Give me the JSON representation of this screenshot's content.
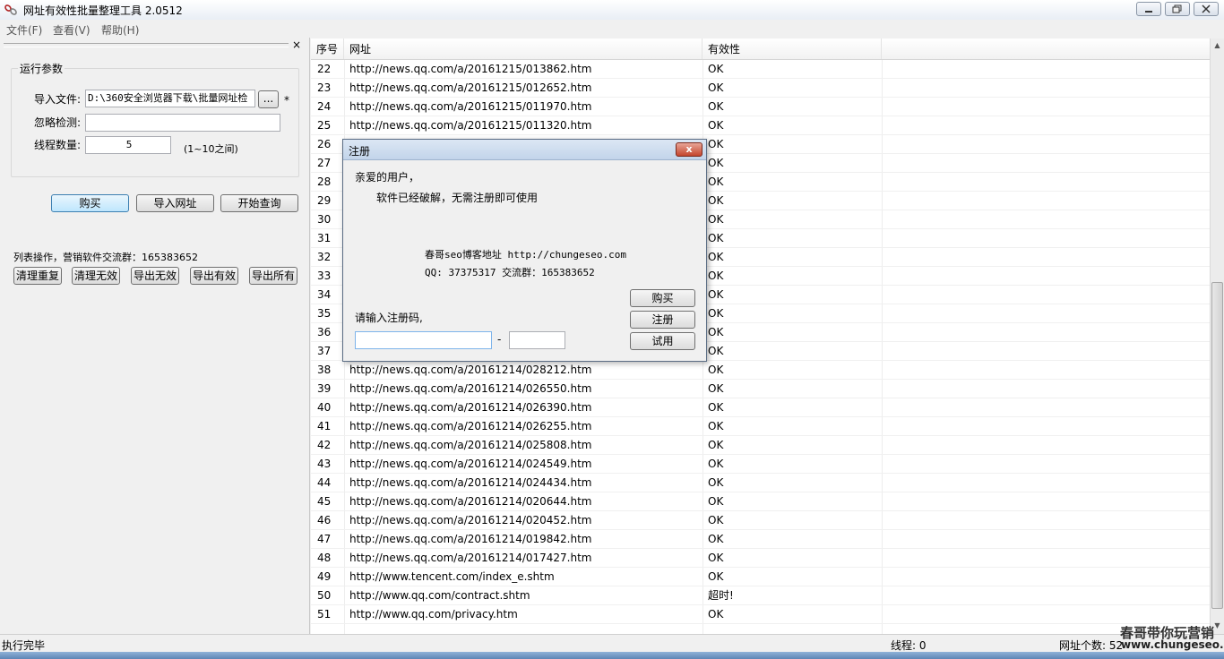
{
  "window": {
    "title": "网址有效性批量整理工具 2.0512",
    "min_icon": "minimize-icon",
    "max_icon": "maximize-icon",
    "close_icon": "close-icon"
  },
  "menu": [
    "文件(F)",
    "查看(V)",
    "帮助(H)"
  ],
  "panel": {
    "group_title": "运行参数",
    "import_label": "导入文件:",
    "import_value": "D:\\360安全浏览器下载\\批量网址检",
    "browse_label": "...",
    "asterisk": "*",
    "ignore_label": "忽略检测:",
    "ignore_value": "",
    "threads_label": "线程数量:",
    "threads_value": "5",
    "threads_hint": "(1~10之间)",
    "buttons": {
      "buy": "购买",
      "import": "导入网址",
      "start": "开始查询"
    },
    "list_ops": "列表操作，营销软件交流群：165383652",
    "list_buttons": [
      "清理重复",
      "清理无效",
      "导出无效",
      "导出有效",
      "导出所有"
    ],
    "close_glyph": "×"
  },
  "table": {
    "columns": [
      "序号",
      "网址",
      "有效性"
    ],
    "rows": [
      {
        "n": "22",
        "url": "http://news.qq.com/a/20161215/013862.htm",
        "status": "OK"
      },
      {
        "n": "23",
        "url": "http://news.qq.com/a/20161215/012652.htm",
        "status": "OK"
      },
      {
        "n": "24",
        "url": "http://news.qq.com/a/20161215/011970.htm",
        "status": "OK"
      },
      {
        "n": "25",
        "url": "http://news.qq.com/a/20161215/011320.htm",
        "status": "OK"
      },
      {
        "n": "26",
        "url": "",
        "status": "OK"
      },
      {
        "n": "27",
        "url": "",
        "status": "OK"
      },
      {
        "n": "28",
        "url": "",
        "status": "OK"
      },
      {
        "n": "29",
        "url": "",
        "status": "OK"
      },
      {
        "n": "30",
        "url": "",
        "status": "OK"
      },
      {
        "n": "31",
        "url": "",
        "status": "OK"
      },
      {
        "n": "32",
        "url": "",
        "status": "OK"
      },
      {
        "n": "33",
        "url": "",
        "status": "OK"
      },
      {
        "n": "34",
        "url": "",
        "status": "OK"
      },
      {
        "n": "35",
        "url": "",
        "status": "OK"
      },
      {
        "n": "36",
        "url": "",
        "status": "OK"
      },
      {
        "n": "37",
        "url": "",
        "status": "OK"
      },
      {
        "n": "38",
        "url": "http://news.qq.com/a/20161214/028212.htm",
        "status": "OK"
      },
      {
        "n": "39",
        "url": "http://news.qq.com/a/20161214/026550.htm",
        "status": "OK"
      },
      {
        "n": "40",
        "url": "http://news.qq.com/a/20161214/026390.htm",
        "status": "OK"
      },
      {
        "n": "41",
        "url": "http://news.qq.com/a/20161214/026255.htm",
        "status": "OK"
      },
      {
        "n": "42",
        "url": "http://news.qq.com/a/20161214/025808.htm",
        "status": "OK"
      },
      {
        "n": "43",
        "url": "http://news.qq.com/a/20161214/024549.htm",
        "status": "OK"
      },
      {
        "n": "44",
        "url": "http://news.qq.com/a/20161214/024434.htm",
        "status": "OK"
      },
      {
        "n": "45",
        "url": "http://news.qq.com/a/20161214/020644.htm",
        "status": "OK"
      },
      {
        "n": "46",
        "url": "http://news.qq.com/a/20161214/020452.htm",
        "status": "OK"
      },
      {
        "n": "47",
        "url": "http://news.qq.com/a/20161214/019842.htm",
        "status": "OK"
      },
      {
        "n": "48",
        "url": "http://news.qq.com/a/20161214/017427.htm",
        "status": "OK"
      },
      {
        "n": "49",
        "url": "http://www.tencent.com/index_e.shtm",
        "status": "OK"
      },
      {
        "n": "50",
        "url": "http://www.qq.com/contract.shtm",
        "status": "超时!"
      },
      {
        "n": "51",
        "url": "http://www.qq.com/privacy.htm",
        "status": "OK"
      }
    ]
  },
  "status": {
    "left": "执行完毕",
    "threads": "线程: 0",
    "count": "网址个数: 52"
  },
  "watermark": {
    "line1": "春哥带你玩营销",
    "line2": "www.chungeseo.com"
  },
  "dialog": {
    "title": "注册",
    "greeting": "亲爱的用户，",
    "message": "软件已经破解，无需注册即可使用",
    "blog": "春哥seo博客地址 http://chungeseo.com",
    "contact": "QQ: 37375317 交流群：165383652",
    "prompt": "请输入注册码,",
    "code_part1": "",
    "code_part2": "",
    "separator": "-",
    "buttons": {
      "buy": "购买",
      "register": "注册",
      "trial": "试用"
    },
    "close_glyph": "x"
  }
}
